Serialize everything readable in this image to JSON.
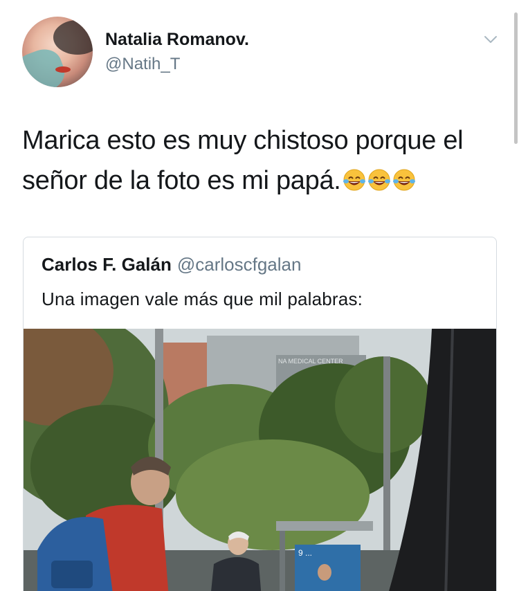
{
  "author": {
    "name": "Natalia Romanov.",
    "handle": "@Natih_T"
  },
  "tweet": {
    "text": "Marica esto es muy chistoso porque el señor de la foto es mi papá.",
    "emojis": [
      "face-with-tears-of-joy",
      "face-with-tears-of-joy",
      "face-with-tears-of-joy"
    ]
  },
  "quoted": {
    "name": "Carlos F. Galán",
    "handle": "@carloscfgalan",
    "text": "Una imagen vale más que mil palabras:",
    "photo": {
      "building_sign": "NA MEDICAL CENTER",
      "poster_text": "9 ..."
    }
  },
  "colors": {
    "text": "#14171a",
    "secondary": "#657786",
    "border": "#d5dbe0"
  }
}
